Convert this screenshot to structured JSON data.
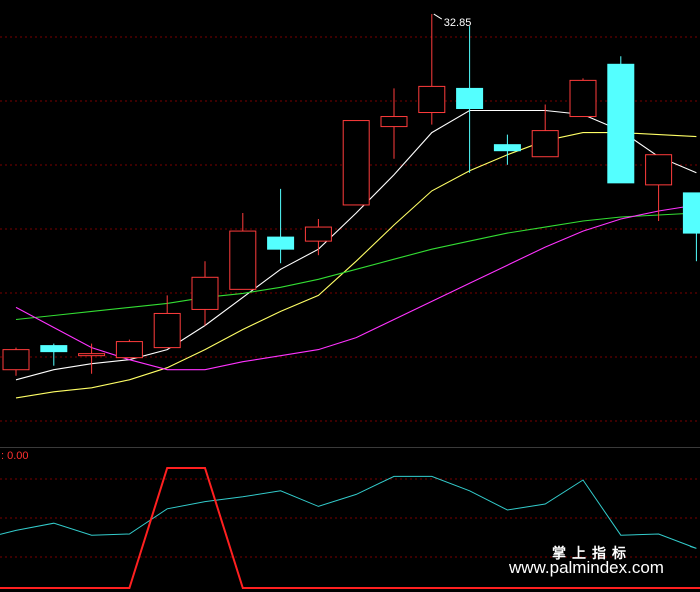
{
  "colors": {
    "background": "#000000",
    "grid": "#7a0000",
    "separator": "#3a3a3a",
    "candle_up": "#ff3c3c",
    "candle_down": "#54ffff",
    "ma_white": "#ffffff",
    "ma_yellow": "#ffff66",
    "ma_green": "#33dd33",
    "ma_magenta": "#ff33ff",
    "indicator_cyan": "#33cccc",
    "indicator_red": "#ff2020"
  },
  "watermark": {
    "line1": "掌上指标",
    "line2": "www.palmindex.com"
  },
  "chart_data": [
    {
      "type": "candlestick",
      "panel": "price",
      "ylim": [
        22.5,
        33.2
      ],
      "high_label": "32.85",
      "high_index": 11,
      "candles": [
        {
          "o": 24.0,
          "c": 24.5,
          "h": 24.55,
          "l": 23.85,
          "dir": "up"
        },
        {
          "o": 24.6,
          "c": 24.45,
          "h": 24.65,
          "l": 24.1,
          "dir": "down"
        },
        {
          "o": 24.35,
          "c": 24.4,
          "h": 24.65,
          "l": 23.9,
          "dir": "up"
        },
        {
          "o": 24.3,
          "c": 24.7,
          "h": 24.75,
          "l": 24.3,
          "dir": "up"
        },
        {
          "o": 24.55,
          "c": 25.4,
          "h": 25.85,
          "l": 24.55,
          "dir": "up"
        },
        {
          "o": 25.5,
          "c": 26.3,
          "h": 26.7,
          "l": 25.1,
          "dir": "up"
        },
        {
          "o": 26.0,
          "c": 27.45,
          "h": 27.9,
          "l": 26.0,
          "dir": "up"
        },
        {
          "o": 27.3,
          "c": 27.0,
          "h": 28.5,
          "l": 26.65,
          "dir": "down"
        },
        {
          "o": 27.2,
          "c": 27.55,
          "h": 27.75,
          "l": 26.85,
          "dir": "up"
        },
        {
          "o": 28.1,
          "c": 30.2,
          "h": 30.2,
          "l": 28.1,
          "dir": "up"
        },
        {
          "o": 30.05,
          "c": 30.3,
          "h": 31.0,
          "l": 29.25,
          "dir": "up"
        },
        {
          "o": 30.4,
          "c": 31.05,
          "h": 32.85,
          "l": 30.1,
          "dir": "up"
        },
        {
          "o": 31.0,
          "c": 30.5,
          "h": 32.55,
          "l": 28.9,
          "dir": "down"
        },
        {
          "o": 29.6,
          "c": 29.45,
          "h": 29.85,
          "l": 29.1,
          "dir": "down"
        },
        {
          "o": 29.3,
          "c": 29.95,
          "h": 30.6,
          "l": 29.3,
          "dir": "up"
        },
        {
          "o": 30.3,
          "c": 31.2,
          "h": 31.25,
          "l": 30.3,
          "dir": "up"
        },
        {
          "o": 31.6,
          "c": 28.65,
          "h": 31.8,
          "l": 28.65,
          "dir": "down"
        },
        {
          "o": 28.6,
          "c": 29.35,
          "h": 29.3,
          "l": 27.7,
          "dir": "up"
        },
        {
          "o": 28.4,
          "c": 27.4,
          "h": 28.4,
          "l": 26.7,
          "dir": "down"
        }
      ],
      "series": [
        {
          "color_key": "ma_white",
          "values": [
            23.75,
            24.0,
            24.15,
            24.25,
            24.5,
            25.1,
            25.8,
            26.5,
            27.0,
            27.9,
            28.85,
            29.9,
            30.45,
            30.45,
            30.45,
            30.35,
            29.95,
            29.3,
            28.9
          ]
        },
        {
          "color_key": "ma_yellow",
          "values": [
            23.3,
            23.45,
            23.55,
            23.75,
            24.05,
            24.5,
            25.0,
            25.45,
            25.85,
            26.7,
            27.6,
            28.45,
            28.95,
            29.35,
            29.7,
            29.9,
            29.9,
            29.85,
            29.8
          ]
        },
        {
          "color_key": "ma_green",
          "values": [
            25.25,
            25.35,
            25.45,
            25.55,
            25.65,
            25.8,
            25.9,
            26.05,
            26.25,
            26.5,
            26.75,
            27.0,
            27.2,
            27.4,
            27.55,
            27.7,
            27.8,
            27.85,
            27.9
          ]
        },
        {
          "color_key": "ma_magenta",
          "values": [
            25.55,
            25.05,
            24.55,
            24.25,
            24.0,
            24.0,
            24.2,
            24.35,
            24.5,
            24.8,
            25.25,
            25.7,
            26.15,
            26.6,
            27.05,
            27.45,
            27.75,
            27.95,
            28.1
          ]
        }
      ]
    },
    {
      "type": "line",
      "panel": "indicator",
      "label": ": 0.00",
      "ylim": [
        0,
        1
      ],
      "series": [
        {
          "color_key": "indicator_cyan",
          "values": [
            0.48,
            0.54,
            0.44,
            0.45,
            0.66,
            0.72,
            0.76,
            0.81,
            0.68,
            0.78,
            0.93,
            0.93,
            0.81,
            0.65,
            0.7,
            0.9,
            0.44,
            0.45,
            0.33
          ]
        },
        {
          "color_key": "indicator_red",
          "values": [
            0,
            0,
            0,
            0,
            1,
            1,
            0,
            0,
            0,
            0,
            0,
            0,
            0,
            0,
            0,
            0,
            0,
            0,
            0
          ]
        }
      ]
    }
  ]
}
